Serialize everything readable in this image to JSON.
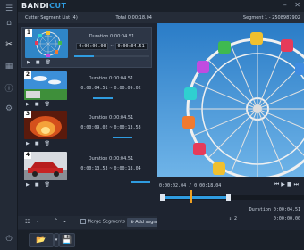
{
  "app": {
    "logo_part1": "BANDI",
    "logo_part2": "CUT"
  },
  "list": {
    "title": "Cutter Segment List (4)",
    "total": "Total 0:00:18.04",
    "segments": [
      {
        "num": "1",
        "duration": "Duration 0:00:04.51",
        "start": "0:00:00.00",
        "end": "0:00:04.51",
        "selected": true
      },
      {
        "num": "2",
        "duration": "Duration 0:00:04.51",
        "start": "0:00:04.51",
        "end": "0:00:09.02",
        "selected": false
      },
      {
        "num": "3",
        "duration": "Duration 0:00:04.51",
        "start": "0:00:09.02",
        "end": "0:00:13.53",
        "selected": false
      },
      {
        "num": "4",
        "duration": "Duration 0:00:04.51",
        "start": "0:00:13.53",
        "end": "0:00:18.04",
        "selected": false
      }
    ],
    "separator": "~",
    "merge_label": "Merge Segments",
    "add_label": "Add segment"
  },
  "preview": {
    "title": "Segment 1 - 2508987902",
    "timecode": "0:00:02.04 / 0:00:18.04",
    "duration_label": "Duration",
    "duration_value": "0:00:04.51",
    "start_value": "0:00:00.00",
    "speed_value": "2"
  },
  "colors": {
    "accent": "#2f9ce0",
    "bg": "#1e2430",
    "panel": "#2d3646"
  }
}
